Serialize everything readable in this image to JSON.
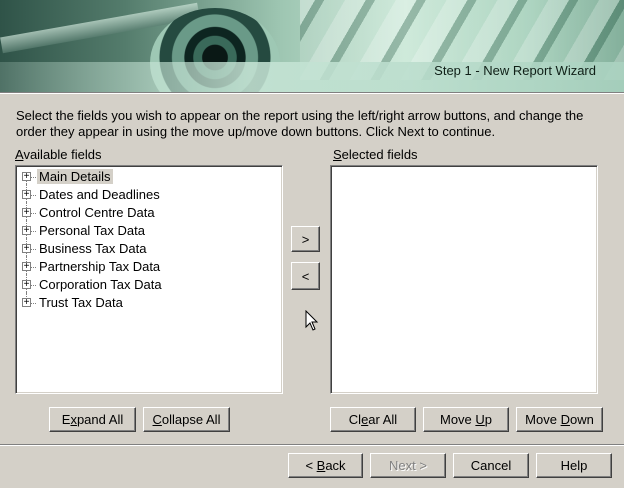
{
  "banner": {
    "step_text": "Step 1 - New Report Wizard"
  },
  "instructions": "Select the fields you wish to appear on the report using the left/right arrow buttons, and change the order they appear in using the move up/move down buttons.  Click Next to continue.",
  "available": {
    "label_ul": "A",
    "label_rest": "vailable fields",
    "items": [
      "Main Details",
      "Dates and Deadlines",
      "Control Centre Data",
      "Personal Tax Data",
      "Business Tax Data",
      "Partnership Tax Data",
      "Corporation Tax Data",
      "Trust Tax Data"
    ],
    "selected_index": 0
  },
  "selected": {
    "label_ul": "S",
    "label_rest": "elected fields",
    "items": []
  },
  "arrows": {
    "add": ">",
    "remove": "<"
  },
  "buttons": {
    "expand_all": {
      "pre": "E",
      "ul": "x",
      "post": "pand All"
    },
    "collapse_all": {
      "pre": "",
      "ul": "C",
      "post": "ollapse All"
    },
    "clear_all": {
      "pre": "Cl",
      "ul": "e",
      "post": "ar All"
    },
    "move_up": {
      "pre": "Move ",
      "ul": "U",
      "post": "p"
    },
    "move_down": {
      "pre": "Move ",
      "ul": "D",
      "post": "own"
    },
    "back": {
      "pre": "< ",
      "ul": "B",
      "post": "ack"
    },
    "next": "Next >",
    "cancel": "Cancel",
    "help": "Help"
  }
}
